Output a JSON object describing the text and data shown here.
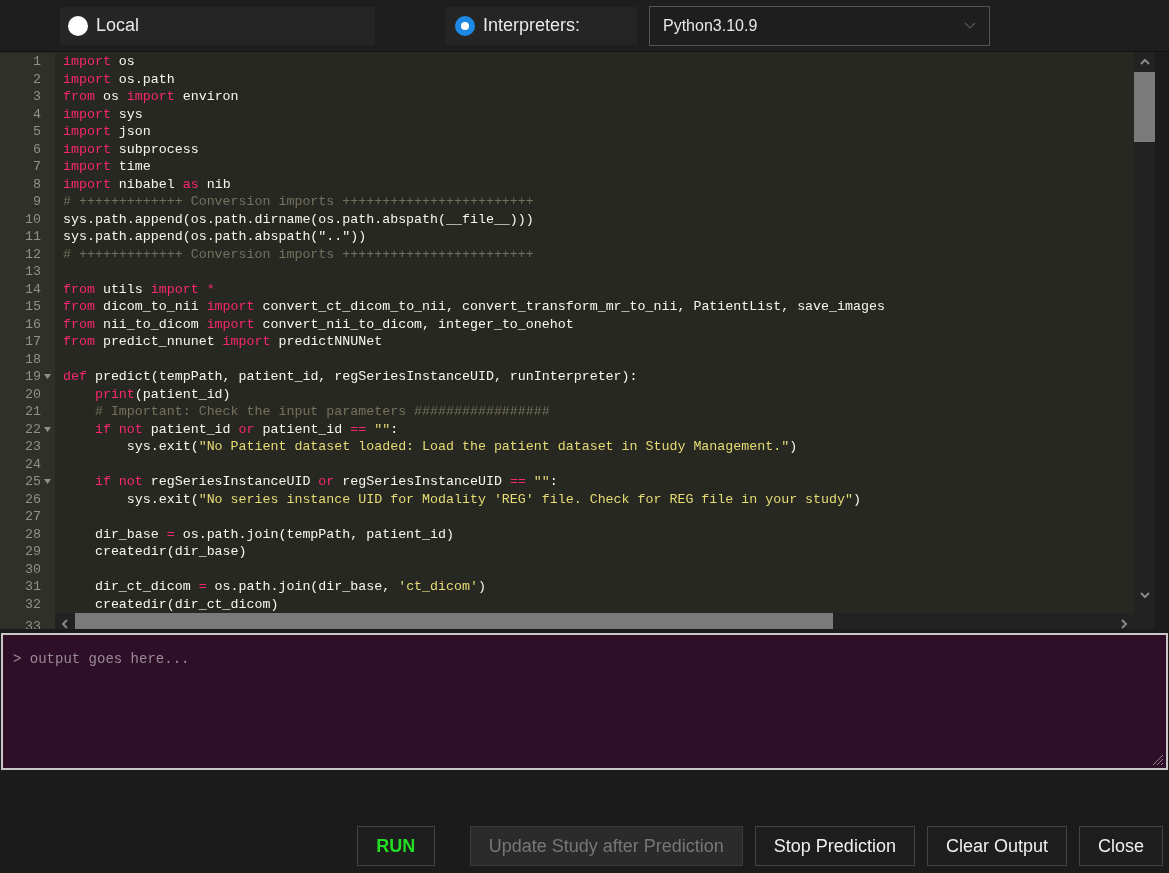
{
  "mode_options": [
    {
      "label": "Local",
      "selected": false
    },
    {
      "label": "Interpreters:",
      "selected": true
    }
  ],
  "interpreter_select": {
    "value": "Python3.10.9"
  },
  "editor": {
    "lines": [
      {
        "number": "1",
        "segments": [
          {
            "kind": "keyword",
            "text": "import"
          },
          {
            "kind": "plain",
            "text": " os"
          }
        ]
      },
      {
        "number": "2",
        "segments": [
          {
            "kind": "keyword",
            "text": "import"
          },
          {
            "kind": "plain",
            "text": " os.path"
          }
        ]
      },
      {
        "number": "3",
        "segments": [
          {
            "kind": "keyword",
            "text": "from"
          },
          {
            "kind": "plain",
            "text": " os "
          },
          {
            "kind": "keyword",
            "text": "import"
          },
          {
            "kind": "plain",
            "text": " environ"
          }
        ]
      },
      {
        "number": "4",
        "segments": [
          {
            "kind": "keyword",
            "text": "import"
          },
          {
            "kind": "plain",
            "text": " sys"
          }
        ]
      },
      {
        "number": "5",
        "segments": [
          {
            "kind": "keyword",
            "text": "import"
          },
          {
            "kind": "plain",
            "text": " json"
          }
        ]
      },
      {
        "number": "6",
        "segments": [
          {
            "kind": "keyword",
            "text": "import"
          },
          {
            "kind": "plain",
            "text": " subprocess"
          }
        ]
      },
      {
        "number": "7",
        "segments": [
          {
            "kind": "keyword",
            "text": "import"
          },
          {
            "kind": "plain",
            "text": " time"
          }
        ]
      },
      {
        "number": "8",
        "segments": [
          {
            "kind": "keyword",
            "text": "import"
          },
          {
            "kind": "plain",
            "text": " nibabel "
          },
          {
            "kind": "keyword",
            "text": "as"
          },
          {
            "kind": "plain",
            "text": " nib"
          }
        ]
      },
      {
        "number": "9",
        "segments": [
          {
            "kind": "comment",
            "text": "# +++++++++++++ Conversion imports ++++++++++++++++++++++++"
          }
        ]
      },
      {
        "number": "10",
        "segments": [
          {
            "kind": "plain",
            "text": "sys.path.append(os.path.dirname(os.path.abspath(__file__)))"
          }
        ]
      },
      {
        "number": "11",
        "segments": [
          {
            "kind": "plain",
            "text": "sys.path.append(os.path.abspath(\"..\"))"
          }
        ]
      },
      {
        "number": "12",
        "segments": [
          {
            "kind": "comment",
            "text": "# +++++++++++++ Conversion imports ++++++++++++++++++++++++"
          }
        ]
      },
      {
        "number": "13"
      },
      {
        "number": "14",
        "segments": [
          {
            "kind": "keyword",
            "text": "from"
          },
          {
            "kind": "plain",
            "text": " utils "
          },
          {
            "kind": "keyword",
            "text": "import *"
          }
        ]
      },
      {
        "number": "15",
        "segments": [
          {
            "kind": "keyword",
            "text": "from"
          },
          {
            "kind": "plain",
            "text": " dicom_to_nii "
          },
          {
            "kind": "keyword",
            "text": "import"
          },
          {
            "kind": "plain",
            "text": " convert_ct_dicom_to_nii, convert_transform_mr_to_nii, PatientList, save_images"
          }
        ]
      },
      {
        "number": "16",
        "segments": [
          {
            "kind": "keyword",
            "text": "from"
          },
          {
            "kind": "plain",
            "text": " nii_to_dicom "
          },
          {
            "kind": "keyword",
            "text": "import"
          },
          {
            "kind": "plain",
            "text": " convert_nii_to_dicom, integer_to_onehot"
          }
        ]
      },
      {
        "number": "17",
        "segments": [
          {
            "kind": "keyword",
            "text": "from"
          },
          {
            "kind": "plain",
            "text": " predict_nnunet "
          },
          {
            "kind": "keyword",
            "text": "import"
          },
          {
            "kind": "plain",
            "text": " predictNNUNet"
          }
        ]
      },
      {
        "number": "18"
      },
      {
        "number": "19",
        "foldable": true,
        "segments": [
          {
            "kind": "keyword",
            "text": "def"
          },
          {
            "kind": "plain",
            "text": " predict(tempPath, patient_id, regSeriesInstanceUID, runInterpreter):"
          }
        ]
      },
      {
        "number": "20",
        "segments": [
          {
            "kind": "keyword",
            "text": "    print"
          },
          {
            "kind": "plain",
            "text": "(patient_id)"
          }
        ]
      },
      {
        "number": "21",
        "segments": [
          {
            "kind": "comment",
            "text": "    # Important: Check the input parameters #################"
          }
        ]
      },
      {
        "number": "22",
        "foldable": true,
        "segments": [
          {
            "kind": "keyword",
            "text": "    if not"
          },
          {
            "kind": "plain",
            "text": " patient_id "
          },
          {
            "kind": "keyword",
            "text": "or"
          },
          {
            "kind": "plain",
            "text": " patient_id "
          },
          {
            "kind": "keyword",
            "text": "== "
          },
          {
            "kind": "string",
            "text": "\"\""
          },
          {
            "kind": "plain",
            "text": ":"
          }
        ]
      },
      {
        "number": "23",
        "segments": [
          {
            "kind": "plain",
            "text": "        sys.exit("
          },
          {
            "kind": "string",
            "text": "\"No Patient dataset loaded: Load the patient dataset in Study Management.\""
          },
          {
            "kind": "plain",
            "text": ")"
          }
        ]
      },
      {
        "number": "24"
      },
      {
        "number": "25",
        "foldable": true,
        "segments": [
          {
            "kind": "keyword",
            "text": "    if not"
          },
          {
            "kind": "plain",
            "text": " regSeriesInstanceUID "
          },
          {
            "kind": "keyword",
            "text": "or"
          },
          {
            "kind": "plain",
            "text": " regSeriesInstanceUID "
          },
          {
            "kind": "keyword",
            "text": "== "
          },
          {
            "kind": "string",
            "text": "\"\""
          },
          {
            "kind": "plain",
            "text": ":"
          }
        ]
      },
      {
        "number": "26",
        "segments": [
          {
            "kind": "plain",
            "text": "        sys.exit("
          },
          {
            "kind": "string",
            "text": "\"No series instance UID for Modality 'REG' file. Check for REG file in your study\""
          },
          {
            "kind": "plain",
            "text": ")"
          }
        ]
      },
      {
        "number": "27"
      },
      {
        "number": "28",
        "segments": [
          {
            "kind": "plain",
            "text": "    dir_base "
          },
          {
            "kind": "keyword",
            "text": "="
          },
          {
            "kind": "plain",
            "text": " os.path.join(tempPath, patient_id)"
          }
        ]
      },
      {
        "number": "29",
        "segments": [
          {
            "kind": "plain",
            "text": "    createdir(dir_base)"
          }
        ]
      },
      {
        "number": "30"
      },
      {
        "number": "31",
        "segments": [
          {
            "kind": "plain",
            "text": "    dir_ct_dicom "
          },
          {
            "kind": "keyword",
            "text": "="
          },
          {
            "kind": "plain",
            "text": " os.path.join(dir_base, "
          },
          {
            "kind": "string",
            "text": "'ct_dicom'"
          },
          {
            "kind": "plain",
            "text": ")"
          }
        ]
      },
      {
        "number": "32",
        "segments": [
          {
            "kind": "plain",
            "text": "    createdir(dir_ct_dicom)"
          }
        ]
      },
      {
        "number": "33"
      }
    ]
  },
  "output": {
    "placeholder": "> output goes here..."
  },
  "buttons": [
    {
      "label": "RUN",
      "kind": "run",
      "disabled": false
    },
    {
      "label": "Update Study after Prediction",
      "kind": "normal",
      "disabled": true
    },
    {
      "label": "Stop Prediction",
      "kind": "normal",
      "disabled": false
    },
    {
      "label": "Clear Output",
      "kind": "normal",
      "disabled": false
    },
    {
      "label": "Close",
      "kind": "normal",
      "disabled": false
    }
  ]
}
